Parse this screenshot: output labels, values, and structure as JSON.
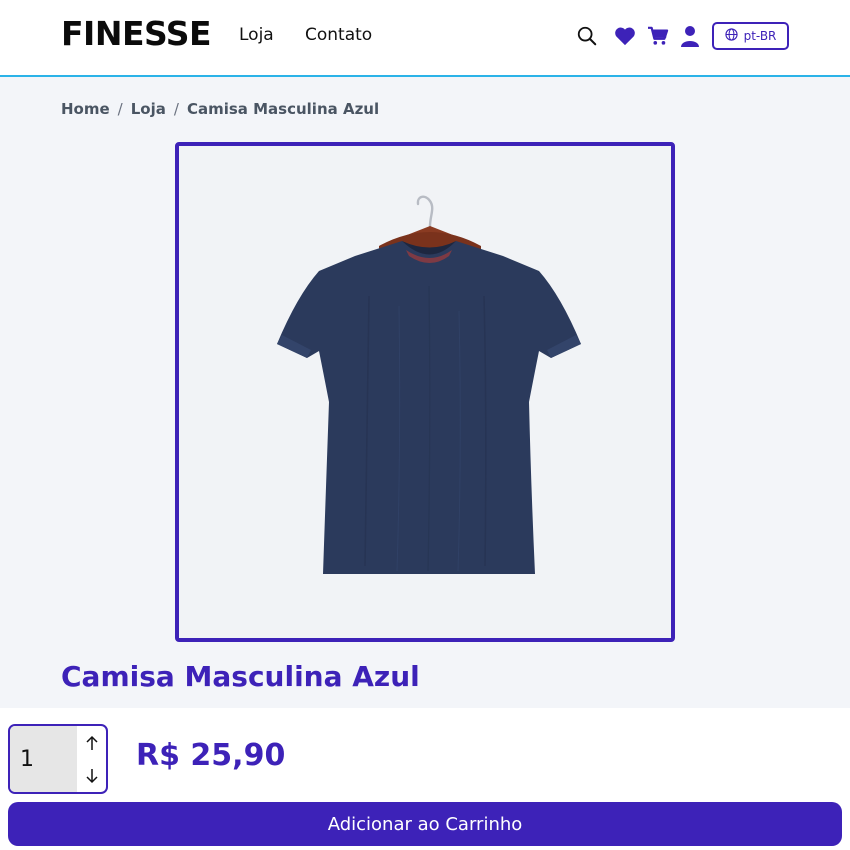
{
  "header": {
    "logo": "FINESSE",
    "nav": [
      {
        "label": "Loja"
      },
      {
        "label": "Contato"
      }
    ],
    "language": "pt-BR",
    "icons": [
      "search-icon",
      "heart-icon",
      "cart-icon",
      "user-icon",
      "globe-icon"
    ]
  },
  "breadcrumb": {
    "items": [
      "Home",
      "Loja",
      "Camisa Masculina Azul"
    ],
    "separator": "/"
  },
  "product": {
    "title": "Camisa Masculina Azul",
    "price": "R$ 25,90",
    "quantity": "1",
    "add_to_cart_label": "Adicionar ao Carrinho"
  },
  "colors": {
    "accent": "#3d22b8",
    "header_border": "#2bb3e8",
    "shirt": "#2b3a5c"
  }
}
